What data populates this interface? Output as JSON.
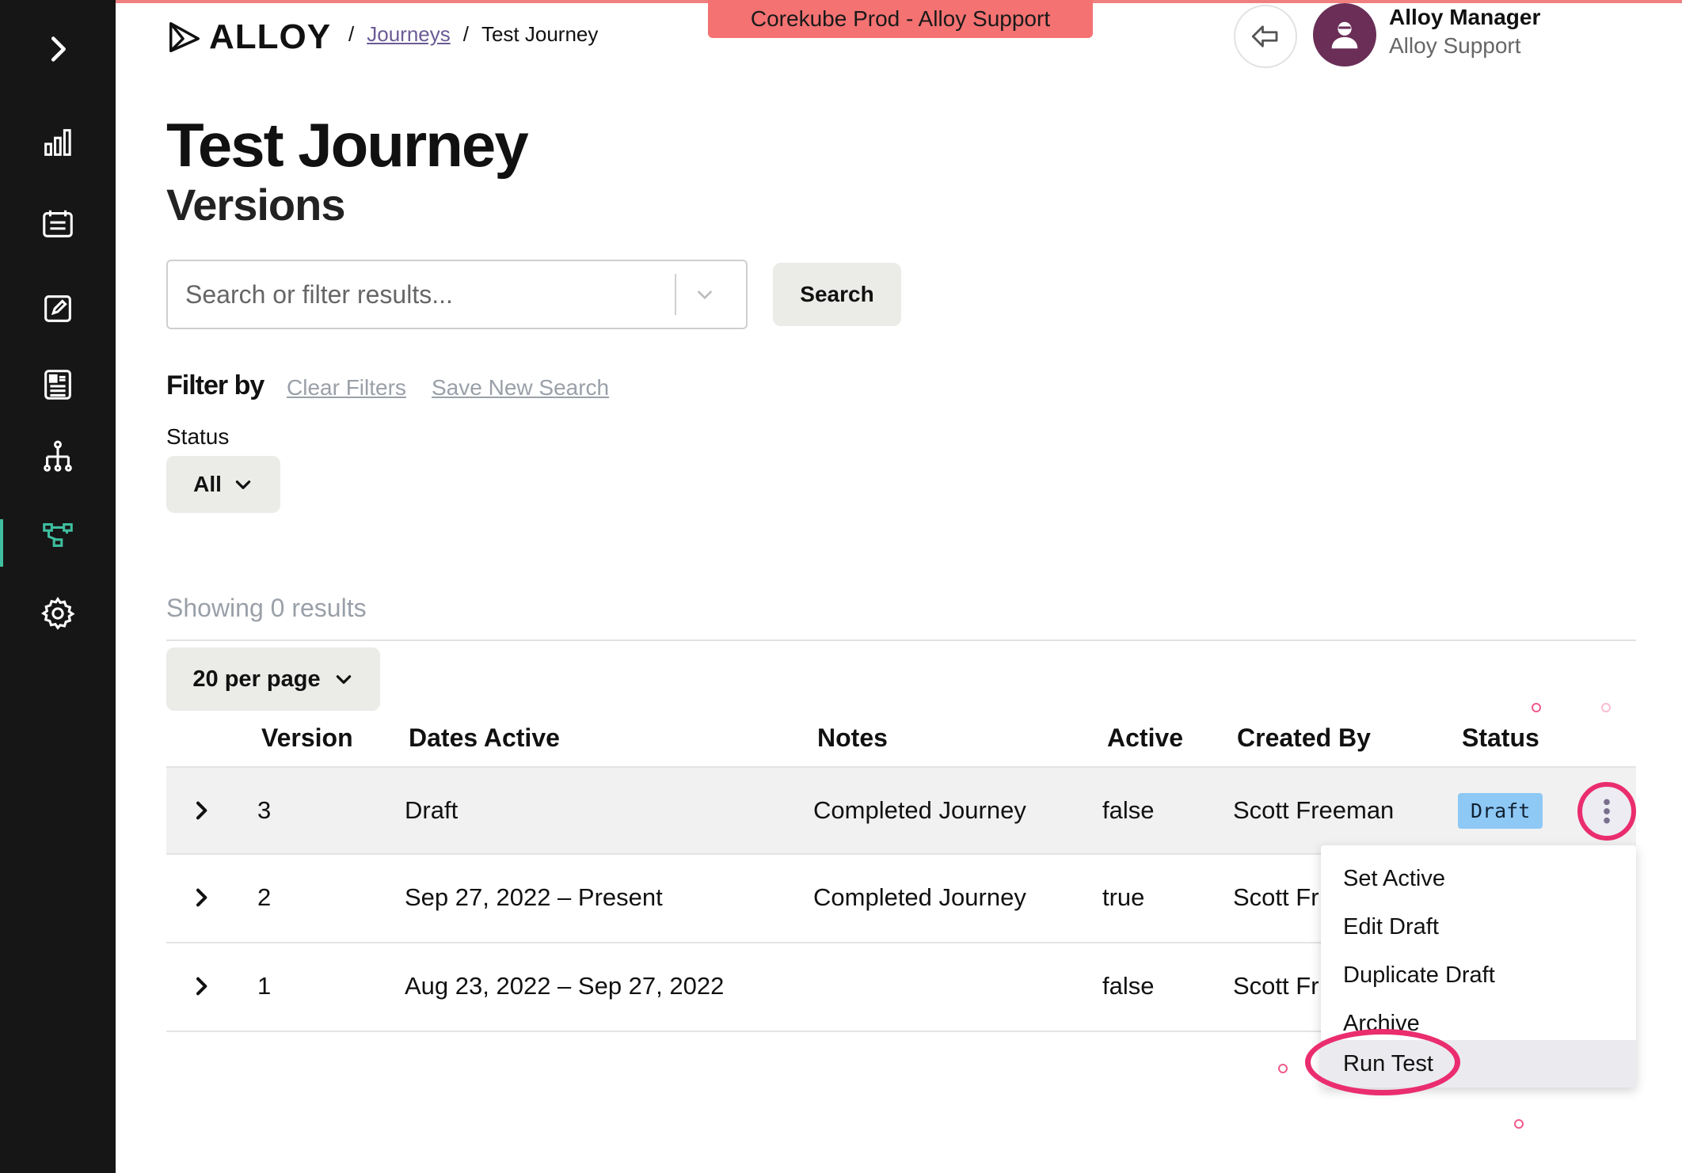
{
  "env_banner": "Corekube Prod - Alloy Support",
  "logo_text": "ALLOY",
  "breadcrumb": {
    "sep1": "/",
    "link": "Journeys",
    "sep2": "/",
    "current": "Test Journey"
  },
  "user": {
    "name": "Alloy Manager",
    "org": "Alloy Support"
  },
  "sidebar": {
    "items": [
      {
        "icon": "chevron-right-icon"
      },
      {
        "icon": "bar-chart-icon"
      },
      {
        "icon": "list-card-icon"
      },
      {
        "icon": "edit-icon"
      },
      {
        "icon": "document-icon"
      },
      {
        "icon": "hierarchy-icon"
      },
      {
        "icon": "workflow-icon",
        "active": true
      },
      {
        "icon": "gear-icon"
      }
    ],
    "accent_color": "#3fbf9f"
  },
  "page": {
    "title": "Test Journey",
    "subtitle": "Versions"
  },
  "search": {
    "placeholder": "Search or filter results...",
    "button": "Search"
  },
  "filters": {
    "label": "Filter by",
    "clear": "Clear Filters",
    "save": "Save New Search",
    "status_label": "Status",
    "status_value": "All"
  },
  "results": {
    "showing": "Showing 0 results",
    "per_page": "20 per page"
  },
  "table": {
    "headers": {
      "version": "Version",
      "dates": "Dates Active",
      "notes": "Notes",
      "active": "Active",
      "created_by": "Created By",
      "status": "Status"
    },
    "rows": [
      {
        "version": "3",
        "dates": "Draft",
        "notes": "Completed Journey",
        "active": "false",
        "created_by": "Scott Freeman",
        "status": "Draft"
      },
      {
        "version": "2",
        "dates": "Sep 27, 2022 – Present",
        "notes": "Completed Journey",
        "active": "true",
        "created_by": "Scott Fr"
      },
      {
        "version": "1",
        "dates": "Aug 23, 2022 – Sep 27, 2022",
        "notes": "",
        "active": "false",
        "created_by": "Scott Fr"
      }
    ]
  },
  "menu": {
    "items": [
      "Set Active",
      "Edit Draft",
      "Duplicate Draft",
      "Archive",
      "Run Test"
    ],
    "hovered": "Run Test"
  },
  "colors": {
    "banner": "#f47272",
    "highlight": "#ea2d6e",
    "draft_badge": "#8ec8f5",
    "avatar": "#6a2e57"
  }
}
